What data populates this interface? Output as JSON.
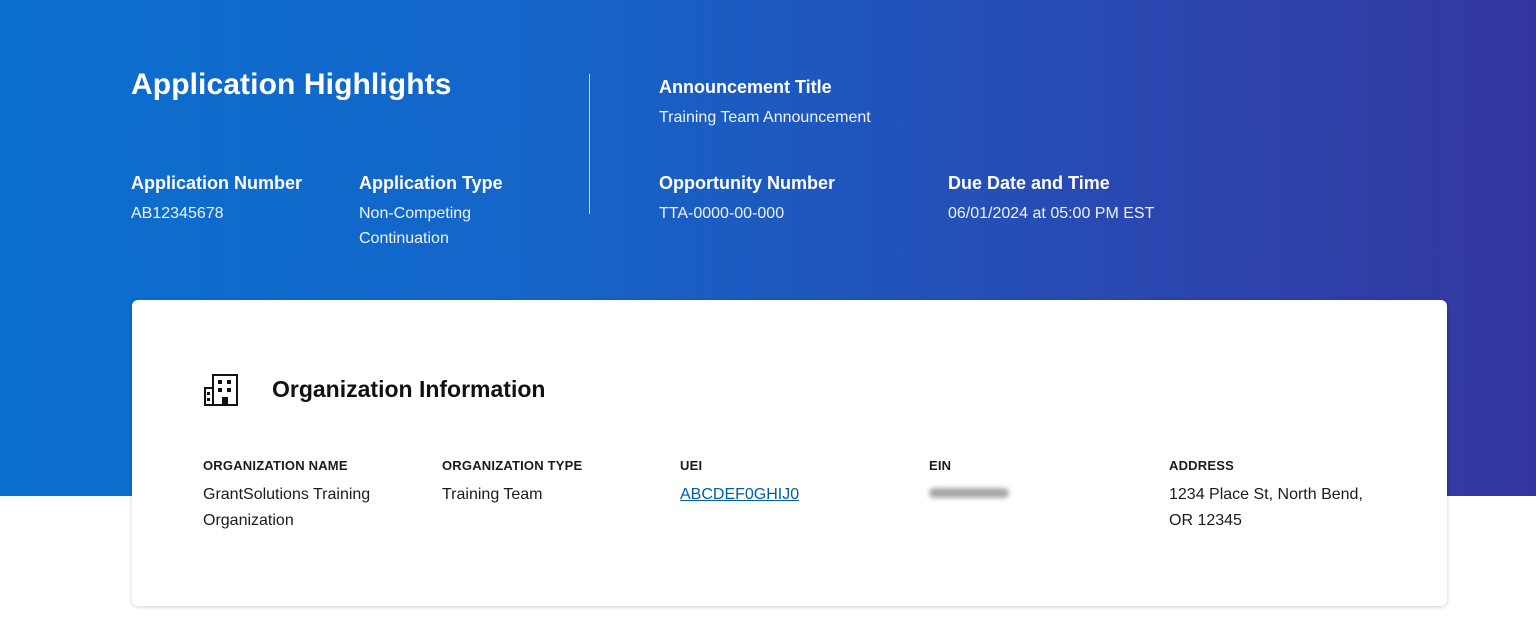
{
  "header": {
    "title": "Application Highlights",
    "application_number": {
      "label": "Application Number",
      "value": "AB12345678"
    },
    "application_type": {
      "label": "Application Type",
      "value": "Non-Competing Continuation"
    },
    "announcement_title": {
      "label": "Announcement Title",
      "value": "Training Team Announcement"
    },
    "opportunity_number": {
      "label": "Opportunity Number",
      "value": "TTA-0000-00-000"
    },
    "due_date": {
      "label": "Due Date and Time",
      "value": "06/01/2024 at 05:00 PM EST"
    }
  },
  "organization": {
    "icon": "building-icon",
    "title": "Organization Information",
    "name": {
      "label": "ORGANIZATION NAME",
      "value": "GrantSolutions Training Organization"
    },
    "type": {
      "label": "ORGANIZATION TYPE",
      "value": "Training Team"
    },
    "uei": {
      "label": "UEI",
      "value": "ABCDEF0GHIJ0"
    },
    "ein": {
      "label": "EIN",
      "value": ""
    },
    "address": {
      "label": "ADDRESS",
      "value": "1234 Place St, North Bend, OR 12345"
    }
  },
  "colors": {
    "hero_gradient_start": "#0a6fce",
    "hero_gradient_end": "#3436a0",
    "link": "#005ea2"
  }
}
